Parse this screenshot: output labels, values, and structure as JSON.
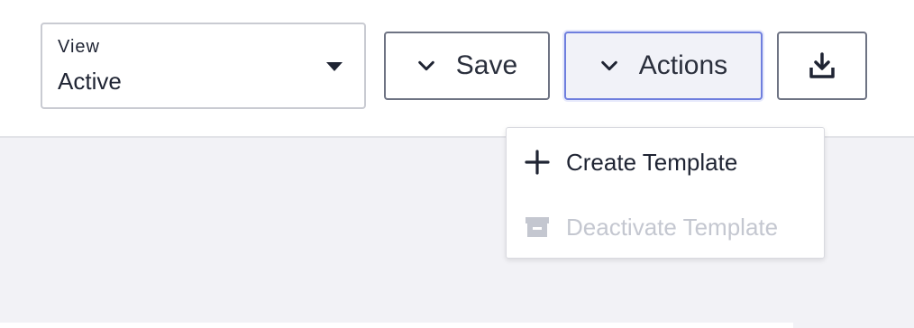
{
  "view_select": {
    "label": "View",
    "value": "Active"
  },
  "buttons": {
    "save_label": "Save",
    "actions_label": "Actions",
    "download_icon": "download-icon"
  },
  "actions_menu": {
    "items": [
      {
        "label": "Create Template",
        "icon": "plus-icon",
        "enabled": true
      },
      {
        "label": "Deactivate Template",
        "icon": "archive-icon",
        "enabled": false
      }
    ]
  },
  "colors": {
    "text": "#1f2433",
    "border": "#c9cbd2",
    "button_border": "#6e7383",
    "actions_active_border": "#6f7fde",
    "actions_active_bg": "#f1f2f8",
    "disabled_text": "#c4c7d0",
    "content_bg": "#f2f2f6"
  }
}
